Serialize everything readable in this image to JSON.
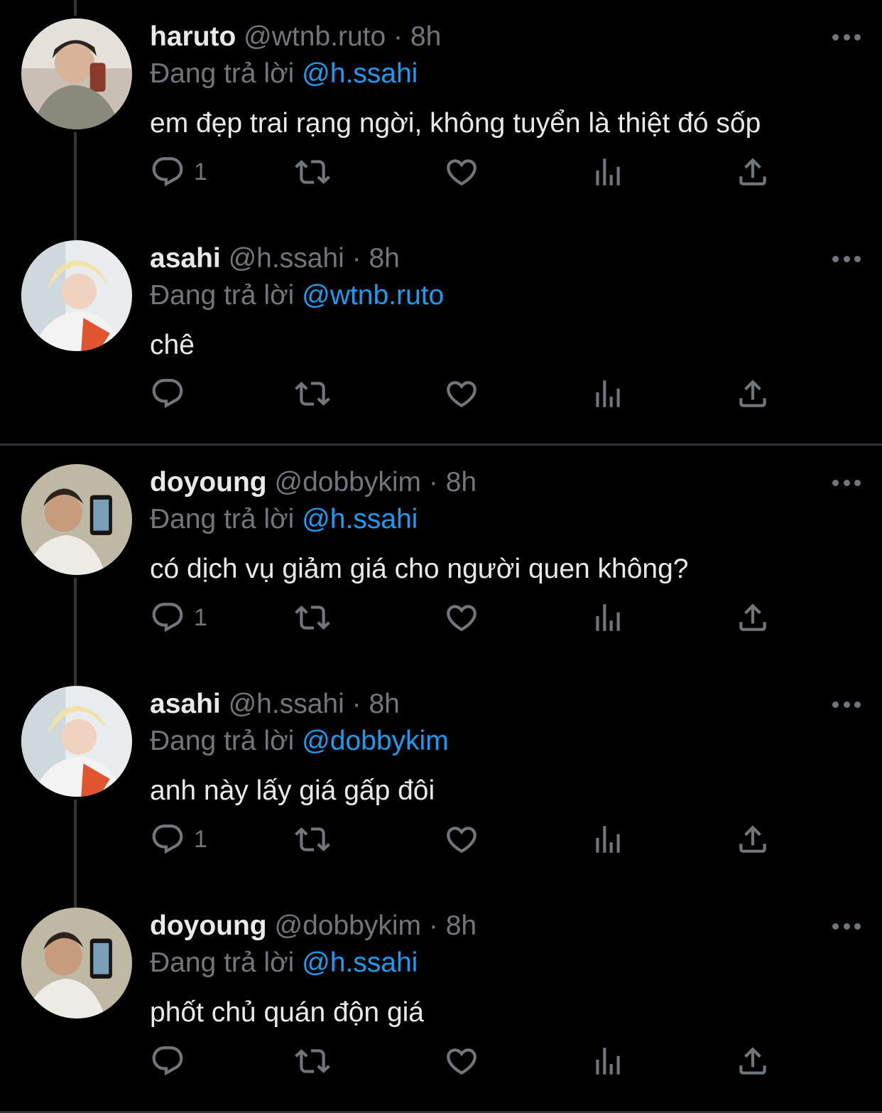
{
  "reply_prefix": "Đang trả lời",
  "threads": [
    {
      "tweets": [
        {
          "name": "haruto",
          "handle": "@wtnb.ruto",
          "separator": "·",
          "time": "8h",
          "reply_to": "@h.ssahi",
          "text": "em đẹp trai rạng ngời, không tuyển là thiệt đó sốp",
          "reply_count": "1",
          "avatar": "haruto-avatar"
        },
        {
          "name": "asahi",
          "handle": "@h.ssahi",
          "separator": "·",
          "time": "8h",
          "reply_to": "@wtnb.ruto",
          "text": "chê",
          "reply_count": "",
          "avatar": "asahi-avatar"
        }
      ]
    },
    {
      "tweets": [
        {
          "name": "doyoung",
          "handle": "@dobbykim",
          "separator": "·",
          "time": "8h",
          "reply_to": "@h.ssahi",
          "text": "có dịch vụ giảm giá cho người quen không?",
          "reply_count": "1",
          "avatar": "doyoung-avatar"
        },
        {
          "name": "asahi",
          "handle": "@h.ssahi",
          "separator": "·",
          "time": "8h",
          "reply_to": "@dobbykim",
          "text": "anh này lấy giá gấp đôi",
          "reply_count": "1",
          "avatar": "asahi-avatar"
        },
        {
          "name": "doyoung",
          "handle": "@dobbykim",
          "separator": "·",
          "time": "8h",
          "reply_to": "@h.ssahi",
          "text": "phốt chủ quán độn giá",
          "reply_count": "",
          "avatar": "doyoung-avatar"
        }
      ]
    }
  ],
  "icons": [
    "reply-icon",
    "retweet-icon",
    "like-icon",
    "views-icon",
    "share-icon",
    "more-icon"
  ],
  "colors": {
    "background": "#000000",
    "text": "#e7e9ea",
    "secondary": "#71767b",
    "mention": "#1d9bf0",
    "divider": "#2f3336"
  }
}
